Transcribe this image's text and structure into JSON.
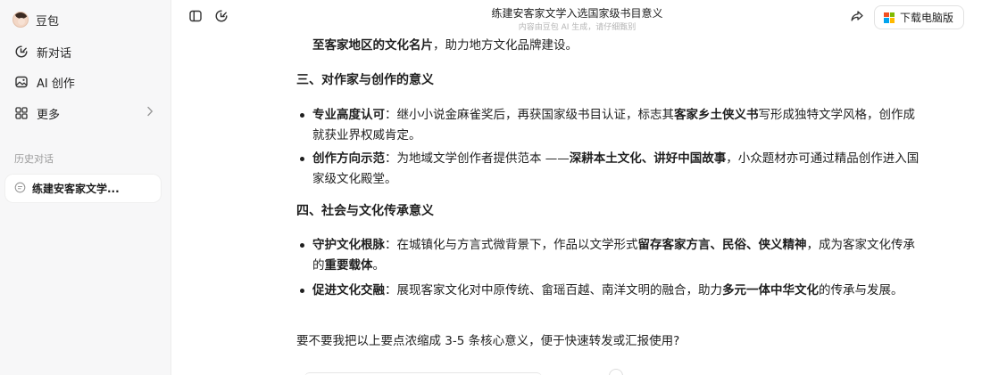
{
  "sidebar": {
    "brand": "豆包",
    "nav": [
      {
        "label": "新对话",
        "icon": "new-chat-icon"
      },
      {
        "label": "AI 创作",
        "icon": "image-icon"
      },
      {
        "label": "更多",
        "icon": "grid-icon"
      }
    ],
    "history_title": "历史对话",
    "history_items": [
      {
        "label": "练建安客家文学..."
      }
    ]
  },
  "header": {
    "title": "练建安客家文学入选国家级书目意义",
    "subtitle": "内容由豆包 AI 生成，请仔细甄别",
    "download_label": "下载电脑版"
  },
  "article": {
    "top_line": {
      "bold": "至客家地区的文化名片",
      "rest": "，助力地方文化品牌建设。"
    },
    "section3": {
      "title": "三、对作家与创作的意义",
      "bullets": [
        {
          "label": "专业高度认可",
          "t1": "：继小小说金麻雀奖后，再获国家级书目认证，标志其",
          "b1": "客家乡土侠义书",
          "t2": "写形成独特文学风格，创作成就获业界权威肯定。"
        },
        {
          "label": "创作方向示范",
          "t1": "：为地域文学创作者提供范本 ——",
          "b1": "深耕本土文化、讲好中国故事",
          "t2": "，小众题材亦可通过精品创作进入国家级文化殿堂。"
        }
      ]
    },
    "section4": {
      "title": "四、社会与文化传承意义",
      "bullets": [
        {
          "label": "守护文化根脉",
          "t1": "：在城镇化与方言式微背景下，作品以文学形式",
          "b1": "留存客家方言、民俗、侠义精神",
          "t2": "，成为客家文化传承的",
          "b2": "重要载体",
          "t3": "。"
        },
        {
          "label": "促进文化交融",
          "t1": "：展现客家文化对中原传统、畲瑶百越、南洋文明的融合，助力",
          "b1": "多元一体中华文化",
          "t2": "的传承与发展。"
        }
      ]
    },
    "closing": "要不要我把以上要点浓缩成 3-5 条核心意义，便于快速转发或汇报使用?"
  },
  "colors": {
    "sidebar_bg": "#f7f7f8",
    "text": "#1f1f1f",
    "muted": "#9a9a9a",
    "ms_red": "#f25022",
    "ms_green": "#7fba00",
    "ms_blue": "#00a4ef",
    "ms_yellow": "#ffb900"
  }
}
